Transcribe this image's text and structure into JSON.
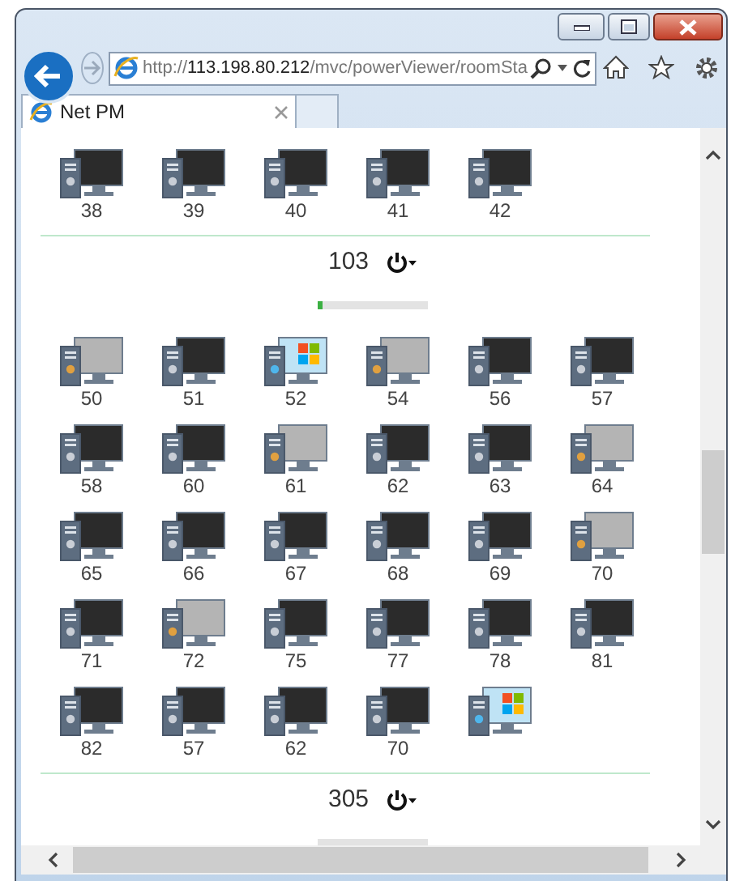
{
  "browser": {
    "address": "http://**113.198.80.212**/mvc/powerViewer/roomSta",
    "tab": {
      "title": "Net PM",
      "selected": true
    }
  },
  "rooms": [
    {
      "computers": [
        {
          "label": "38",
          "kind": "off"
        },
        {
          "label": "39",
          "kind": "off"
        },
        {
          "label": "40",
          "kind": "off"
        },
        {
          "label": "41",
          "kind": "off"
        },
        {
          "label": "42",
          "kind": "off"
        }
      ]
    },
    {
      "name": "103",
      "level": 0.04,
      "computers": [
        {
          "label": "50",
          "kind": "sleep"
        },
        {
          "label": "51",
          "kind": "off"
        },
        {
          "label": "52",
          "kind": "on"
        },
        {
          "label": "54",
          "kind": "sleep"
        },
        {
          "label": "56",
          "kind": "off"
        },
        {
          "label": "57",
          "kind": "off"
        },
        {
          "label": "58",
          "kind": "off"
        },
        {
          "label": "60",
          "kind": "off"
        },
        {
          "label": "61",
          "kind": "sleep"
        },
        {
          "label": "62",
          "kind": "off"
        },
        {
          "label": "63",
          "kind": "off"
        },
        {
          "label": "64",
          "kind": "sleep"
        },
        {
          "label": "65",
          "kind": "off"
        },
        {
          "label": "66",
          "kind": "off"
        },
        {
          "label": "67",
          "kind": "off"
        },
        {
          "label": "68",
          "kind": "off"
        },
        {
          "label": "69",
          "kind": "off"
        },
        {
          "label": "70",
          "kind": "sleep"
        },
        {
          "label": "71",
          "kind": "off"
        },
        {
          "label": "72",
          "kind": "sleep"
        },
        {
          "label": "75",
          "kind": "off"
        },
        {
          "label": "77",
          "kind": "off"
        },
        {
          "label": "78",
          "kind": "off"
        },
        {
          "label": "81",
          "kind": "off"
        },
        {
          "label": "82",
          "kind": "off"
        },
        {
          "label": "57",
          "kind": "off"
        },
        {
          "label": "62",
          "kind": "off"
        },
        {
          "label": "70",
          "kind": "off"
        },
        {
          "kind": "on"
        }
      ]
    },
    {
      "name": "305"
    }
  ]
}
